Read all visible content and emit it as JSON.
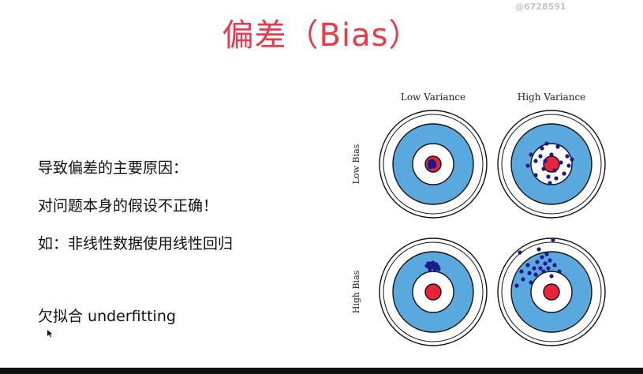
{
  "watermark": "@6728591",
  "title": "偏差（Bias）",
  "lines": [
    "导致偏差的主要原因：",
    "对问题本身的假设不正确！",
    "如：非线性数据使用线性回归",
    "欠拟合 underfitting"
  ],
  "diagram": {
    "column_labels": [
      "Low Variance",
      "High Variance"
    ],
    "row_labels": [
      "Low Bias",
      "High Bias"
    ],
    "colors": {
      "ring_white": "#ffffff",
      "ring_blue": "#5aa9de",
      "bullseye": "#e8243a",
      "shot": "#1a1a8a",
      "stroke": "#111111"
    },
    "targets": [
      {
        "name": "low-bias-low-variance",
        "shots": [
          [
            -4,
            -3
          ],
          [
            -2,
            0
          ],
          [
            1,
            -2
          ],
          [
            -3,
            3
          ],
          [
            0,
            2
          ],
          [
            -5,
            1
          ],
          [
            2,
            1
          ],
          [
            -1,
            -4
          ],
          [
            -4,
            4
          ],
          [
            0,
            -1
          ],
          [
            -2,
            3
          ],
          [
            1,
            3
          ]
        ]
      },
      {
        "name": "low-bias-high-variance",
        "shots": [
          [
            -12,
            -20
          ],
          [
            -14,
            -10
          ],
          [
            -20,
            -4
          ],
          [
            -10,
            6
          ],
          [
            -4,
            16
          ],
          [
            6,
            18
          ],
          [
            16,
            12
          ],
          [
            22,
            2
          ],
          [
            20,
            -10
          ],
          [
            8,
            -22
          ],
          [
            -6,
            -26
          ],
          [
            -26,
            -12
          ],
          [
            -20,
            14
          ],
          [
            0,
            -12
          ],
          [
            12,
            -2
          ],
          [
            -8,
            -4
          ],
          [
            4,
            8
          ],
          [
            -30,
            2
          ],
          [
            26,
            -6
          ],
          [
            -2,
            24
          ]
        ]
      },
      {
        "name": "high-bias-low-variance",
        "shots": [
          [
            -7,
            -34
          ],
          [
            -3,
            -36
          ],
          [
            1,
            -33
          ],
          [
            4,
            -35
          ],
          [
            -5,
            -31
          ],
          [
            -1,
            -32
          ],
          [
            3,
            -31
          ],
          [
            6,
            -32
          ],
          [
            -8,
            -33
          ],
          [
            0,
            -37
          ],
          [
            -4,
            -29
          ],
          [
            2,
            -29
          ],
          [
            7,
            -29
          ],
          [
            -6,
            -36
          ]
        ]
      },
      {
        "name": "high-bias-high-variance",
        "shots": [
          [
            -12,
            -44
          ],
          [
            -18,
            -38
          ],
          [
            -22,
            -30
          ],
          [
            -8,
            -36
          ],
          [
            -4,
            -30
          ],
          [
            -14,
            -30
          ],
          [
            -28,
            -24
          ],
          [
            -36,
            -16
          ],
          [
            -20,
            -22
          ],
          [
            -10,
            -26
          ],
          [
            -2,
            -40
          ],
          [
            4,
            -34
          ],
          [
            -26,
            -12
          ],
          [
            -6,
            -48
          ],
          [
            -38,
            -26
          ],
          [
            2,
            -66
          ],
          [
            -40,
            -50
          ],
          [
            -16,
            -54
          ],
          [
            10,
            -26
          ],
          [
            -30,
            -34
          ],
          [
            0,
            -20
          ],
          [
            -44,
            -8
          ]
        ]
      }
    ]
  }
}
